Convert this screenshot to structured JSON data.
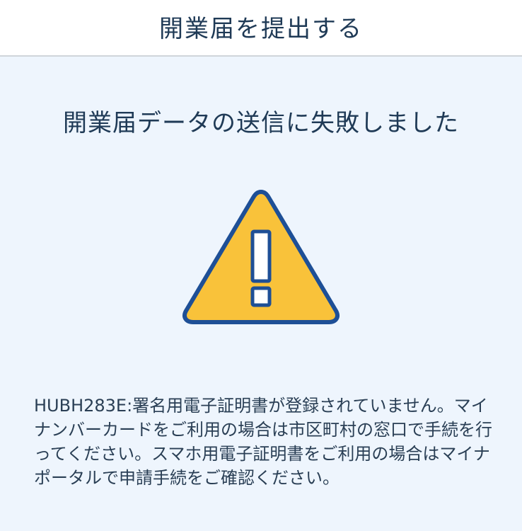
{
  "header": {
    "title": "開業届を提出する"
  },
  "main": {
    "error_title": "開業届データの送信に失敗しました",
    "icon": "warning-icon",
    "error_message": "HUBH283E:署名用電子証明書が登録されていません。マイナンバーカードをご利用の場合は市区町村の窓口で手続を行ってください。スマホ用電子証明書をご利用の場合はマイナポータルで申請手続をご確認ください。"
  },
  "colors": {
    "warning_fill": "#f9c23a",
    "warning_stroke": "#1e4f96",
    "background": "#eef5fd",
    "text": "#1f3a56"
  }
}
